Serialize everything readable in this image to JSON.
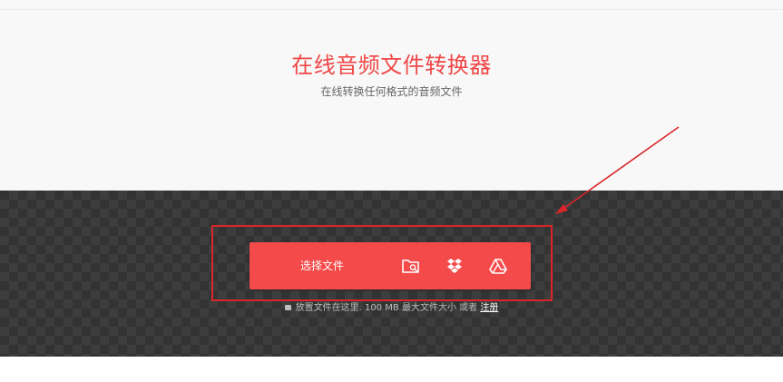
{
  "header": {
    "title": "在线音频文件转换器",
    "subtitle": "在线转换任何格式的音频文件"
  },
  "upload": {
    "choose_file_label": "选择文件",
    "sources": [
      {
        "icon": "folder-search-icon"
      },
      {
        "icon": "dropbox-icon"
      },
      {
        "icon": "google-drive-icon"
      }
    ]
  },
  "drop_note": {
    "lock_icon": "lock-icon",
    "text": "放置文件在这里. 100 MB 最大文件大小 或者",
    "signup_link": "注册"
  },
  "colors": {
    "accent": "#f44a4a",
    "title": "#f04646",
    "annotation": "#d9262a",
    "dropzone_bg": "#333333"
  }
}
